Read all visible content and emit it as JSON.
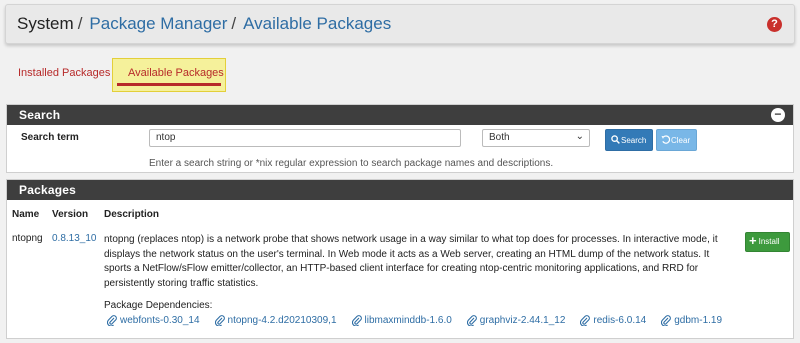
{
  "breadcrumb": {
    "root": "System",
    "section": "Package Manager",
    "page": "Available Packages"
  },
  "tabs": [
    {
      "label": "Installed Packages"
    },
    {
      "label": "Available Packages"
    }
  ],
  "search": {
    "heading": "Search",
    "term_label": "Search term",
    "term_value": "ntop",
    "scope_value": "Both",
    "search_button": "Search",
    "clear_button": "Clear",
    "help_text": "Enter a search string or *nix regular expression to search package names and descriptions."
  },
  "packages": {
    "heading": "Packages",
    "columns": {
      "name": "Name",
      "version": "Version",
      "description": "Description"
    },
    "rows": [
      {
        "name": "ntopng",
        "version": "0.8.13_10",
        "description": "ntopng (replaces ntop) is a network probe that shows network usage in a way similar to what top does for processes. In interactive mode, it displays the network status on the user's terminal. In Web mode it acts as a Web server, creating an HTML dump of the network status. It sports a NetFlow/sFlow emitter/collector, an HTTP-based client interface for creating ntop-centric monitoring applications, and RRD for persistently storing traffic statistics.",
        "deps_label": "Package Dependencies:",
        "dependencies": [
          {
            "label": "webfonts-0.30_14"
          },
          {
            "label": "ntopng-4.2.d20210309,1"
          },
          {
            "label": "libmaxminddb-1.6.0"
          },
          {
            "label": "graphviz-2.44.1_12"
          },
          {
            "label": "redis-6.0.14"
          },
          {
            "label": "gdbm-1.19"
          }
        ],
        "install_button": "Install"
      }
    ]
  },
  "colors": {
    "link": "#2e6da4",
    "tab_active_bg": "#f5f19b",
    "heading_bg": "#3e3e3e",
    "install_green": "#3d9a3d"
  }
}
